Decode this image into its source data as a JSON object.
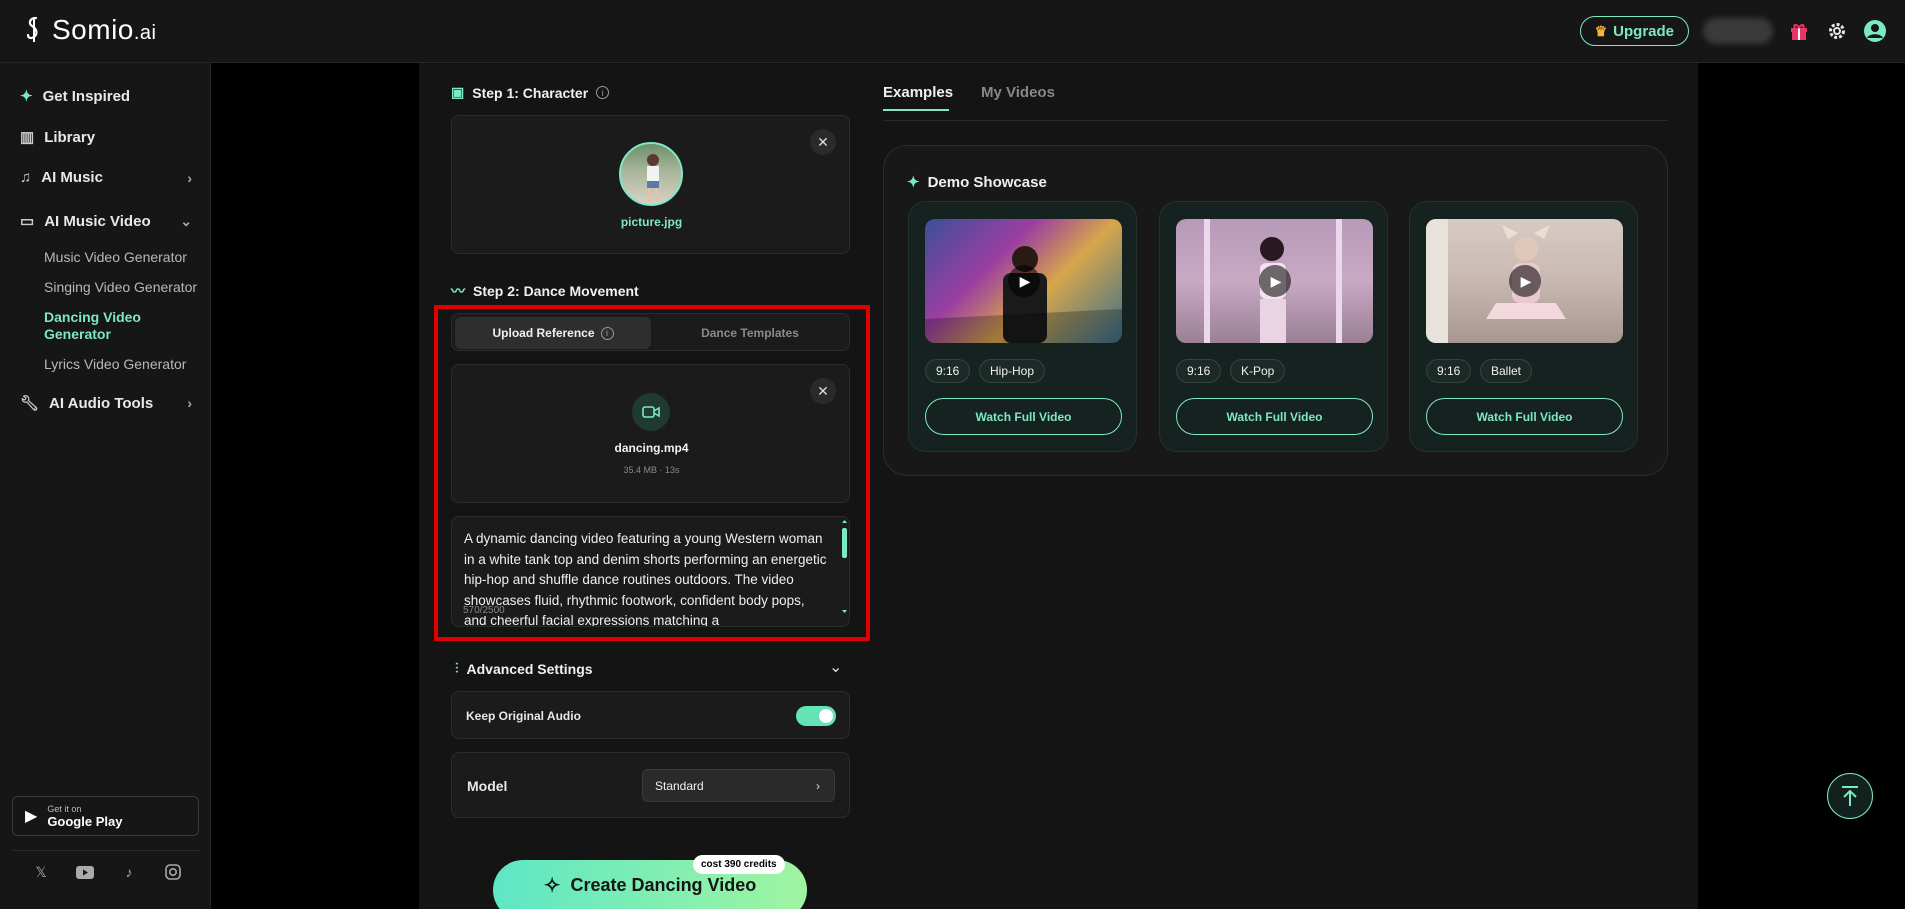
{
  "brand": {
    "name": "Somio",
    "suffix": ".ai"
  },
  "header": {
    "upgrade_label": "Upgrade"
  },
  "sidebar": {
    "items": [
      {
        "label": "Get Inspired"
      },
      {
        "label": "Library"
      },
      {
        "label": "AI Music"
      },
      {
        "label": "AI Music Video"
      },
      {
        "label": "AI Audio Tools"
      }
    ],
    "sub_items": [
      {
        "label": "Music Video Generator"
      },
      {
        "label": "Singing Video Generator"
      },
      {
        "label": "Dancing Video Generator"
      },
      {
        "label": "Lyrics Video Generator"
      }
    ],
    "google_play": {
      "small": "Get it on",
      "big": "Google Play"
    }
  },
  "step1": {
    "title": "Step 1: Character",
    "file_name": "picture.jpg"
  },
  "step2": {
    "title": "Step 2: Dance Movement",
    "tabs": [
      {
        "label": "Upload Reference"
      },
      {
        "label": "Dance Templates"
      }
    ],
    "file_name": "dancing.mp4",
    "file_meta": "35.4 MB · 13s",
    "description": "A dynamic dancing video featuring a young Western woman in a white tank top and denim shorts performing an energetic hip-hop and shuffle dance routines outdoors. The video showcases fluid, rhythmic footwork, confident body pops, and cheerful facial expressions matching a",
    "char_count": "570/2500"
  },
  "advanced": {
    "title": "Advanced Settings",
    "keep_audio_label": "Keep Original Audio",
    "keep_audio_on": true,
    "model_label": "Model",
    "model_value": "Standard"
  },
  "create": {
    "label": "Create Dancing Video",
    "cost": "cost 390 credits"
  },
  "right_tabs": [
    {
      "label": "Examples"
    },
    {
      "label": "My Videos"
    }
  ],
  "showcase": {
    "title": "Demo Showcase",
    "videos": [
      {
        "ratio": "9:16",
        "genre": "Hip-Hop",
        "button": "Watch Full Video"
      },
      {
        "ratio": "9:16",
        "genre": "K-Pop",
        "button": "Watch Full Video"
      },
      {
        "ratio": "9:16",
        "genre": "Ballet",
        "button": "Watch Full Video"
      }
    ]
  },
  "colors": {
    "accent": "#7de8c4",
    "highlight": "#e00000",
    "background": "#141414"
  },
  "icons": [
    "sparkle-icon",
    "library-icon",
    "music-note-icon",
    "video-camera-icon",
    "wrench-icon",
    "chevron-right-icon",
    "chevron-down-icon",
    "gift-icon",
    "gear-icon",
    "avatar-icon",
    "crown-icon",
    "close-icon",
    "info-icon",
    "image-icon",
    "pulse-icon",
    "sliders-icon",
    "magic-wand-icon",
    "play-icon",
    "arrow-up-icon",
    "x-icon",
    "youtube-icon",
    "tiktok-icon",
    "instagram-icon",
    "google-play-icon"
  ]
}
